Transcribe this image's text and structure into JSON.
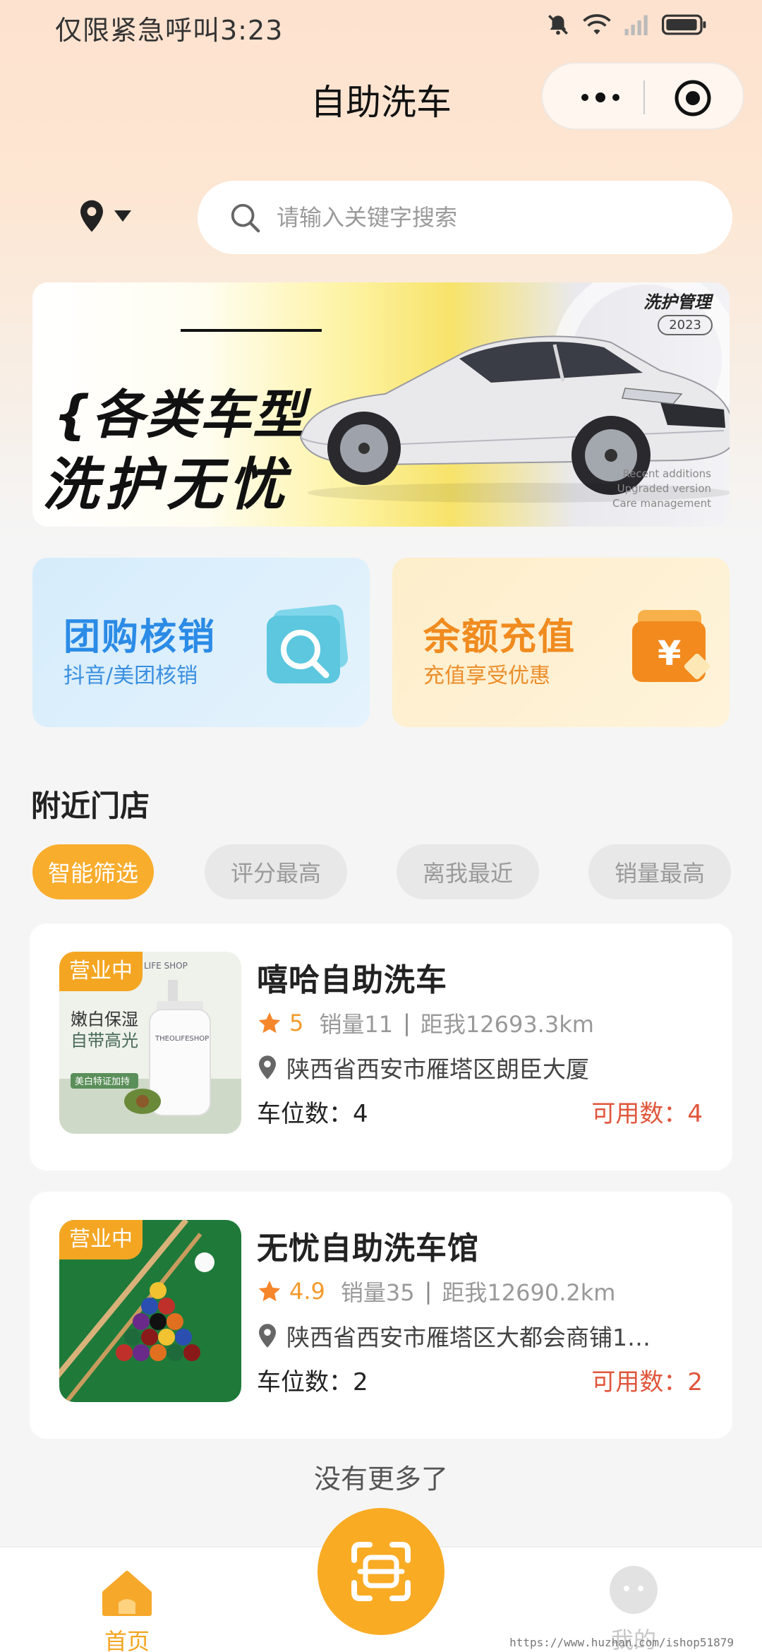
{
  "status_bar": {
    "carrier_time": "仅限紧急呼叫3:23"
  },
  "nav": {
    "title": "自助洗车"
  },
  "search": {
    "placeholder": "请输入关键字搜索"
  },
  "banner": {
    "line1": "{各类车型",
    "line2": "洗护无忧",
    "brand": "洗护管理",
    "year": "2023",
    "sub": [
      "Recent additions",
      "Upgraded version",
      "Care management"
    ]
  },
  "features": [
    {
      "title": "团购核销",
      "subtitle": "抖音/美团核销",
      "icon": "search-bag-icon"
    },
    {
      "title": "余额充值",
      "subtitle": "充值享受优惠",
      "icon": "wallet-yen-icon"
    }
  ],
  "nearby": {
    "title": "附近门店",
    "filters": [
      {
        "label": "智能筛选",
        "active": true
      },
      {
        "label": "评分最高",
        "active": false
      },
      {
        "label": "离我最近",
        "active": false
      },
      {
        "label": "销量最高",
        "active": false
      }
    ]
  },
  "stores": [
    {
      "badge": "营业中",
      "name": "嘻哈自助洗车",
      "score": "5",
      "sales": "销量11",
      "distance": "距我12693.3km",
      "address": "陕西省西安市雁塔区朗臣大厦",
      "spots": "车位数：4",
      "available": "可用数：4",
      "image_text": {
        "brand": "LIFE SHOP",
        "line1": "嫩白保湿",
        "line2": "自带高光",
        "tag": "美白特证加持",
        "product": "THEOLIFESHOP"
      }
    },
    {
      "badge": "营业中",
      "name": "无忧自助洗车馆",
      "score": "4.9",
      "sales": "销量35",
      "distance": "距我12690.2km",
      "address": "陕西省西安市雁塔区大都会商铺1…",
      "spots": "车位数：2",
      "available": "可用数：2"
    }
  ],
  "footer": {
    "no_more": "没有更多了"
  },
  "tabbar": {
    "home": "首页",
    "me": "我的",
    "scan_icon": "scan-icon"
  },
  "watermark": "https://www.huzhan.com/ishop51879",
  "colors": {
    "accent": "#f9ad2d",
    "blue": "#2b8be6",
    "orange": "#f08b1f",
    "red": "#e0563b"
  }
}
